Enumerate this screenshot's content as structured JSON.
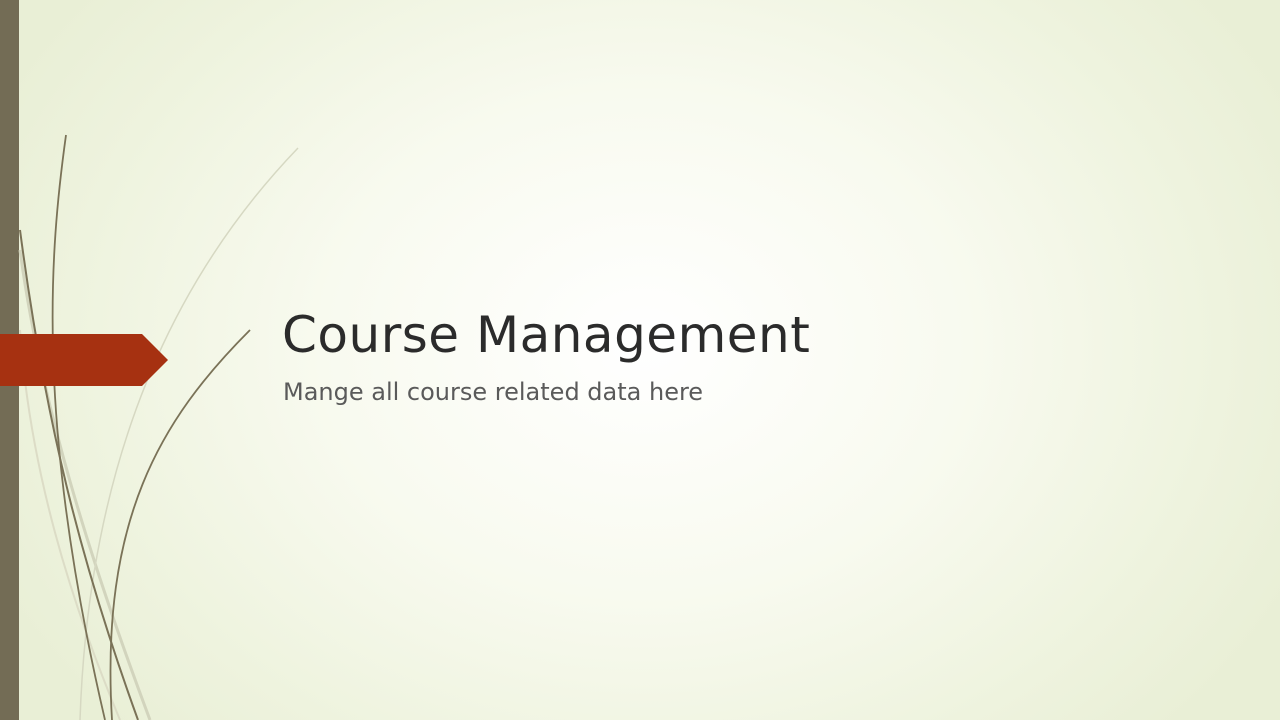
{
  "slide": {
    "title": "Course Management",
    "subtitle": "Mange all course related data here"
  },
  "theme": {
    "accent_bar_color": "#736c55",
    "tab_color": "#a63111",
    "line_color": "#7a7257",
    "light_line_color": "#cfd1b9",
    "background_center": "#ffffff",
    "background_edge": "#e9efd6"
  }
}
